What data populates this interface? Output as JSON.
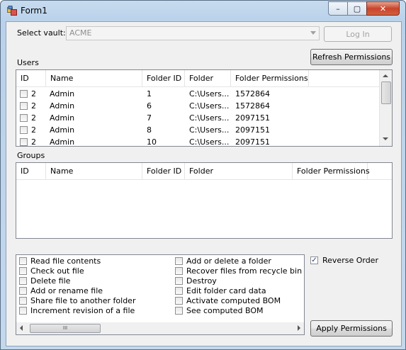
{
  "window": {
    "title": "Form1",
    "minimize": "–",
    "maximize": "▢",
    "close": "✕"
  },
  "vault": {
    "label": "Select vault:",
    "value": "ACME",
    "login_label": "Log In"
  },
  "users": {
    "label": "Users",
    "refresh_label": "Refresh Permissions",
    "columns": [
      "ID",
      "Name",
      "Folder ID",
      "Folder",
      "Folder Permissions"
    ],
    "rows": [
      {
        "id": "2",
        "name": "Admin",
        "folder_id": "1",
        "folder": "C:\\Users...",
        "perm": "1572864"
      },
      {
        "id": "2",
        "name": "Admin",
        "folder_id": "6",
        "folder": "C:\\Users...",
        "perm": "1572864"
      },
      {
        "id": "2",
        "name": "Admin",
        "folder_id": "7",
        "folder": "C:\\Users...",
        "perm": "2097151"
      },
      {
        "id": "2",
        "name": "Admin",
        "folder_id": "8",
        "folder": "C:\\Users...",
        "perm": "2097151"
      },
      {
        "id": "2",
        "name": "Admin",
        "folder_id": "10",
        "folder": "C:\\Users...",
        "perm": "2097151"
      }
    ]
  },
  "groups": {
    "label": "Groups",
    "columns": [
      "ID",
      "Name",
      "Folder ID",
      "Folder",
      "Folder Permissions"
    ]
  },
  "permissions": {
    "col1": [
      "Read file contents",
      "Check out file",
      "Delete file",
      "Add or rename file",
      "Share file to another folder",
      "Increment revision of a file"
    ],
    "col2": [
      "Add or delete a folder",
      "Recover files from recycle bin",
      "Destroy",
      "Edit folder card data",
      "Activate computed BOM",
      "See computed BOM"
    ]
  },
  "reverse_order": {
    "label": "Reverse Order",
    "checked": true,
    "check_glyph": "✓"
  },
  "apply_label": "Apply Permissions",
  "scroll": {
    "grip": "III"
  }
}
